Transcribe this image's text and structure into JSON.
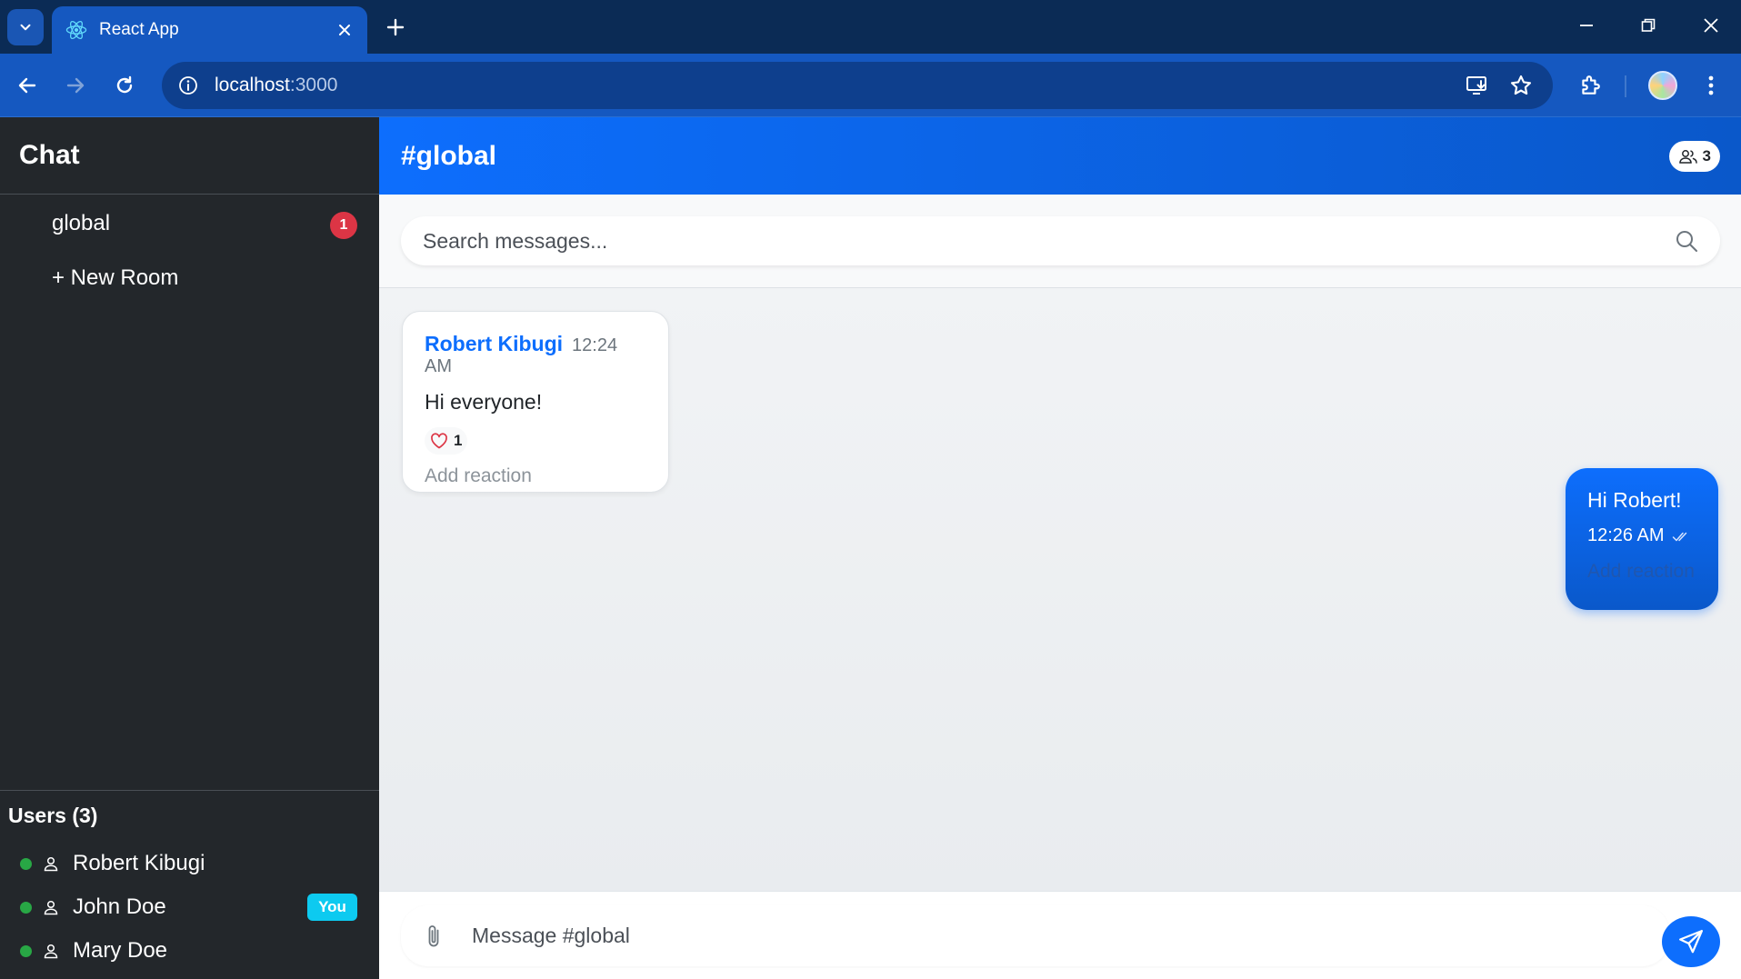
{
  "browser": {
    "tab_title": "React App",
    "url_host": "localhost",
    "url_port": ":3000"
  },
  "sidebar": {
    "title": "Chat",
    "rooms": [
      {
        "label": "global",
        "unread": "1"
      }
    ],
    "new_room_label": "+ New Room",
    "users_title": "Users (3)",
    "users": [
      {
        "name": "Robert Kibugi",
        "status": "online"
      },
      {
        "name": "John Doe",
        "status": "online",
        "badge": "You"
      },
      {
        "name": "Mary Doe",
        "status": "online"
      }
    ]
  },
  "main": {
    "room_title": "#global",
    "member_count": "3",
    "search_placeholder": "Search messages...",
    "messages": [
      {
        "author": "Robert Kibugi",
        "time": "12:24 AM",
        "text": "Hi everyone!",
        "reaction_count": "1",
        "add_reaction_label": "Add reaction"
      },
      {
        "text": "Hi Robert!",
        "time": "12:26 AM",
        "add_reaction_label": "Add reaction",
        "own": true
      }
    ],
    "composer_placeholder": "Message #global"
  },
  "colors": {
    "accent": "#0d6efd",
    "sidebar_bg": "#23272b",
    "unread_badge": "#dc3545",
    "online": "#28a745",
    "you_badge": "#0dcaf0"
  }
}
